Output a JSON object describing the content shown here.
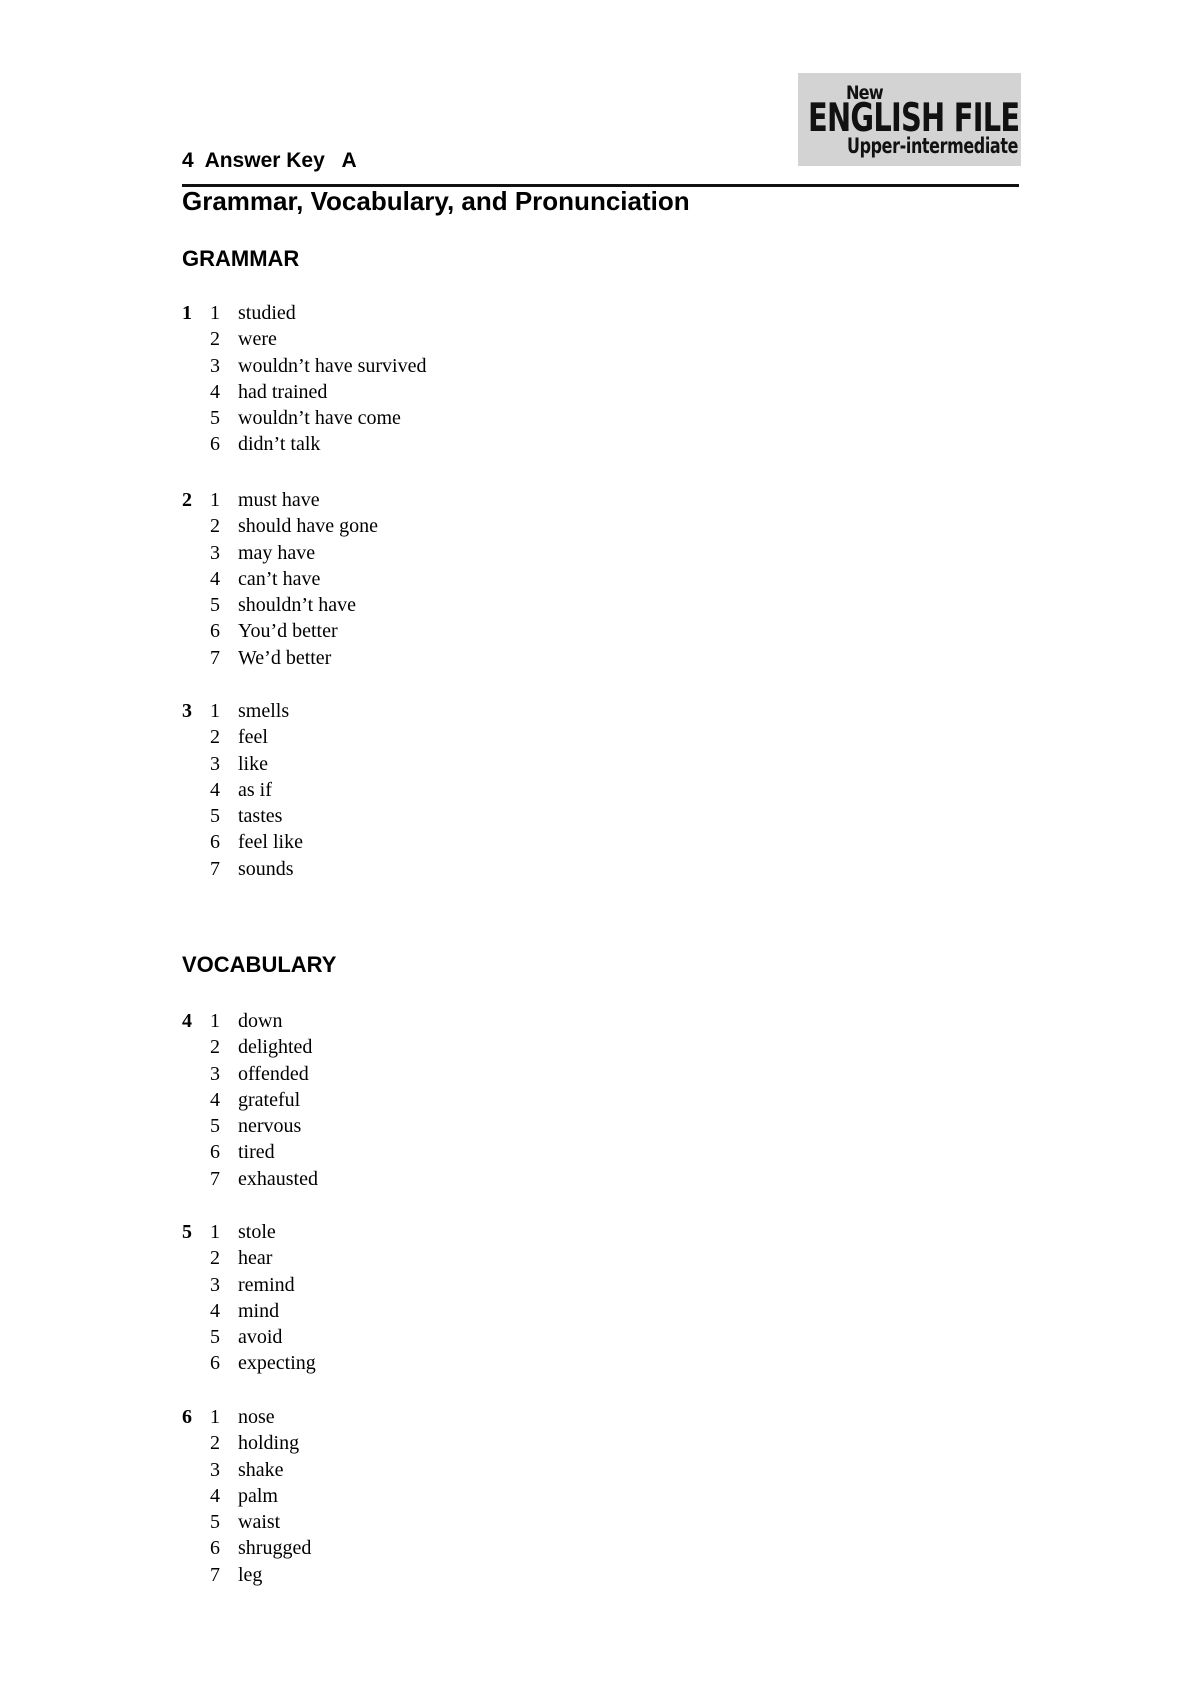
{
  "logo": {
    "line1": "New",
    "line2": "ENGLISH FILE",
    "line3": "Upper-intermediate"
  },
  "header": {
    "title": "4  Answer Key   A",
    "subtitle": "Grammar, Vocabulary, and Pronunciation"
  },
  "sections": {
    "grammar": {
      "heading": "GRAMMAR",
      "exercises": [
        {
          "number": "1",
          "items": [
            {
              "n": "1",
              "answer": "studied"
            },
            {
              "n": "2",
              "answer": "were"
            },
            {
              "n": "3",
              "answer": "wouldn’t have survived"
            },
            {
              "n": "4",
              "answer": "had trained"
            },
            {
              "n": "5",
              "answer": "wouldn’t have come"
            },
            {
              "n": "6",
              "answer": "didn’t talk"
            }
          ]
        },
        {
          "number": "2",
          "items": [
            {
              "n": "1",
              "answer": "must have"
            },
            {
              "n": "2",
              "answer": "should have gone"
            },
            {
              "n": "3",
              "answer": "may have"
            },
            {
              "n": "4",
              "answer": "can’t have"
            },
            {
              "n": "5",
              "answer": "shouldn’t have"
            },
            {
              "n": "6",
              "answer": "You’d better"
            },
            {
              "n": "7",
              "answer": "We’d better"
            }
          ]
        },
        {
          "number": "3",
          "items": [
            {
              "n": "1",
              "answer": "smells"
            },
            {
              "n": "2",
              "answer": "feel"
            },
            {
              "n": "3",
              "answer": "like"
            },
            {
              "n": "4",
              "answer": "as if"
            },
            {
              "n": "5",
              "answer": "tastes"
            },
            {
              "n": "6",
              "answer": "feel like"
            },
            {
              "n": "7",
              "answer": "sounds"
            }
          ]
        }
      ]
    },
    "vocabulary": {
      "heading": "VOCABULARY",
      "exercises": [
        {
          "number": "4",
          "items": [
            {
              "n": "1",
              "answer": "down"
            },
            {
              "n": "2",
              "answer": "delighted"
            },
            {
              "n": "3",
              "answer": "offended"
            },
            {
              "n": "4",
              "answer": "grateful"
            },
            {
              "n": "5",
              "answer": "nervous"
            },
            {
              "n": "6",
              "answer": "tired"
            },
            {
              "n": "7",
              "answer": "exhausted"
            }
          ]
        },
        {
          "number": "5",
          "items": [
            {
              "n": "1",
              "answer": "stole"
            },
            {
              "n": "2",
              "answer": "hear"
            },
            {
              "n": "3",
              "answer": "remind"
            },
            {
              "n": "4",
              "answer": "mind"
            },
            {
              "n": "5",
              "answer": "avoid"
            },
            {
              "n": "6",
              "answer": "expecting"
            }
          ]
        },
        {
          "number": "6",
          "items": [
            {
              "n": "1",
              "answer": "nose"
            },
            {
              "n": "2",
              "answer": "holding"
            },
            {
              "n": "3",
              "answer": "shake"
            },
            {
              "n": "4",
              "answer": "palm"
            },
            {
              "n": "5",
              "answer": "waist"
            },
            {
              "n": "6",
              "answer": "shrugged"
            },
            {
              "n": "7",
              "answer": "leg"
            }
          ]
        }
      ]
    }
  }
}
